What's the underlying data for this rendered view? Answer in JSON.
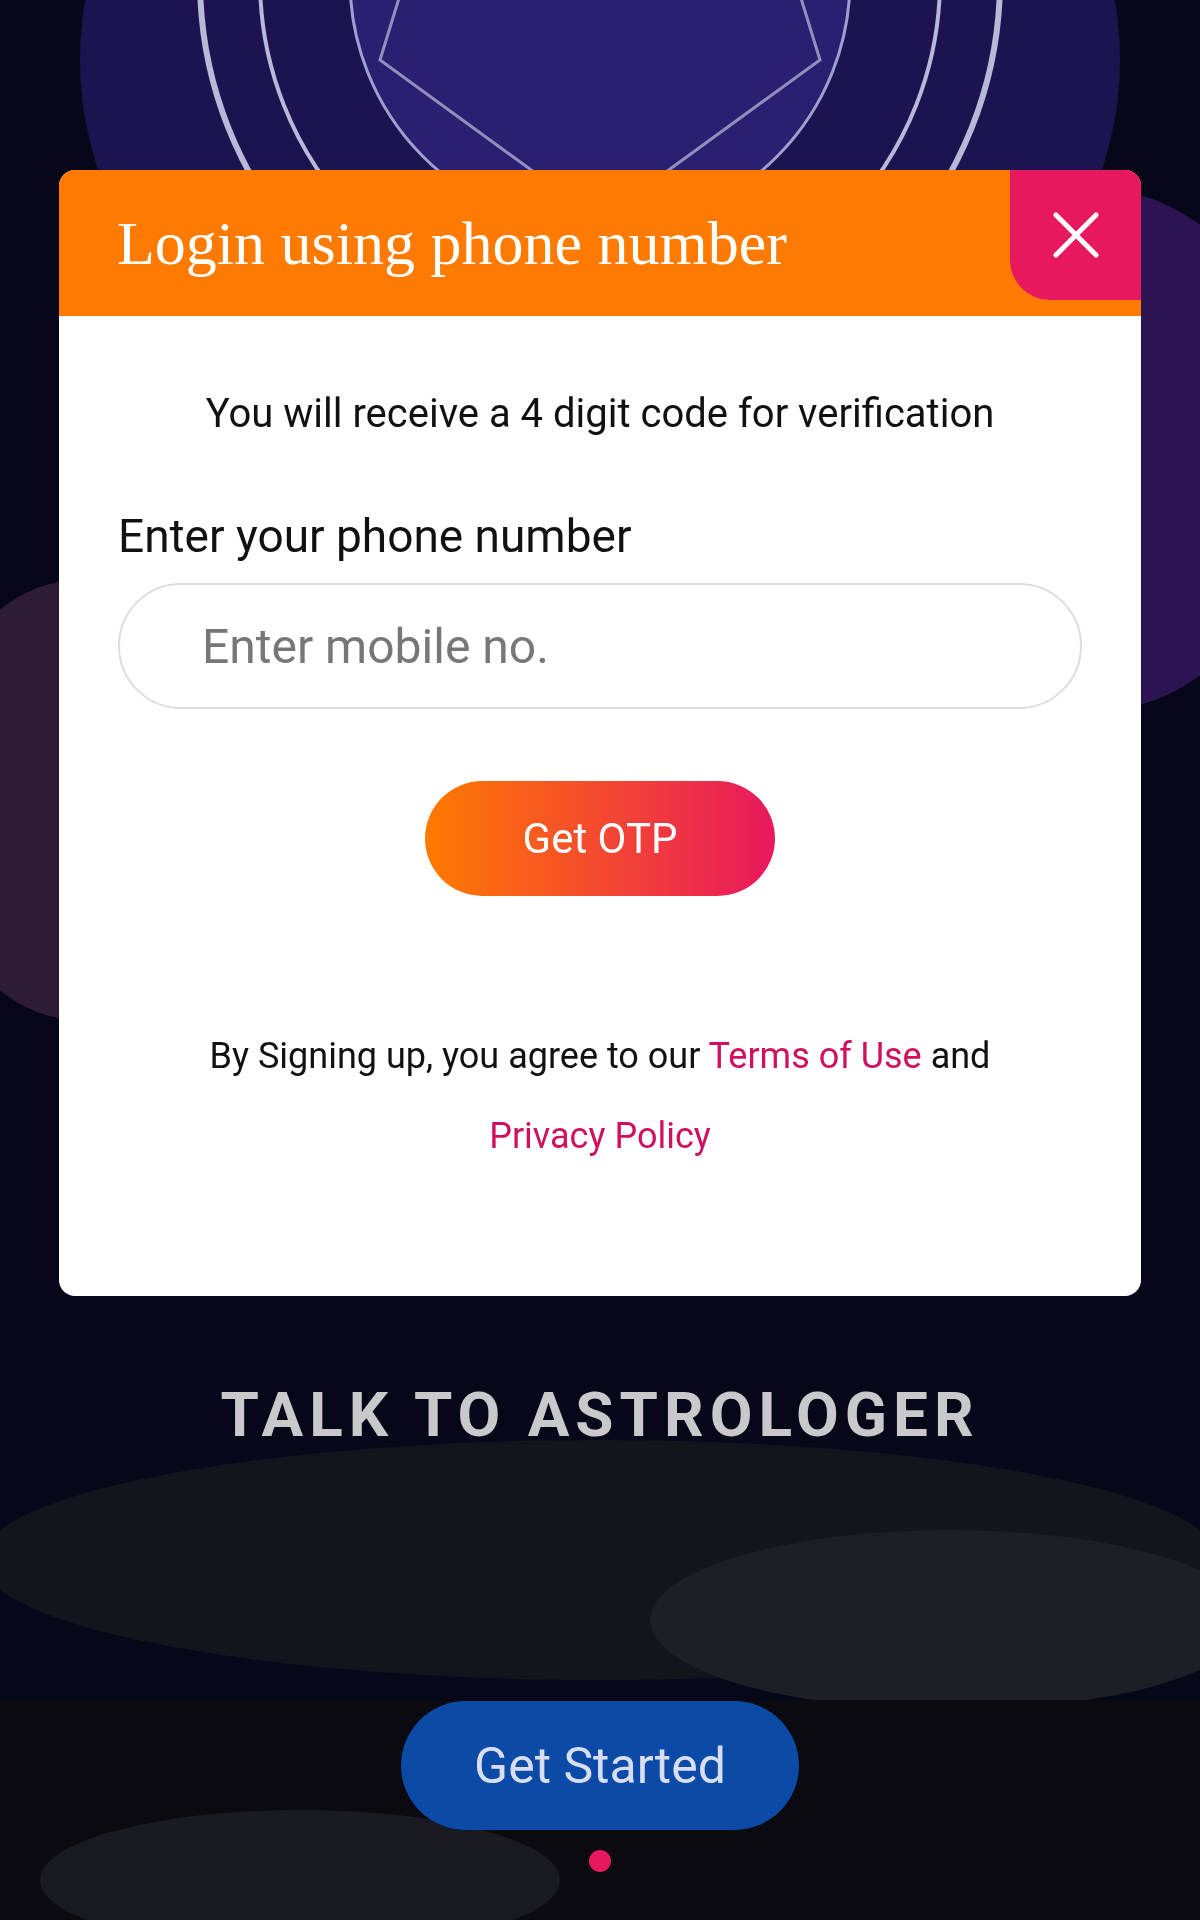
{
  "modal": {
    "title": "Login using phone number",
    "subtitle": "You will receive a 4 digit code for verification",
    "field_label": "Enter your phone number",
    "phone_field": {
      "placeholder": "Enter mobile no."
    },
    "submit_button": "Get OTP",
    "consent": {
      "text_before": "By Signing up, you agree to our ",
      "terms_link": "Terms of Use",
      "text_middle": " and ",
      "privacy_link": "Privacy Policy"
    }
  },
  "tagline": "TALK TO ASTROLOGER",
  "start_button": "Get Started",
  "pager": [
    {
      "selected": true
    }
  ]
}
